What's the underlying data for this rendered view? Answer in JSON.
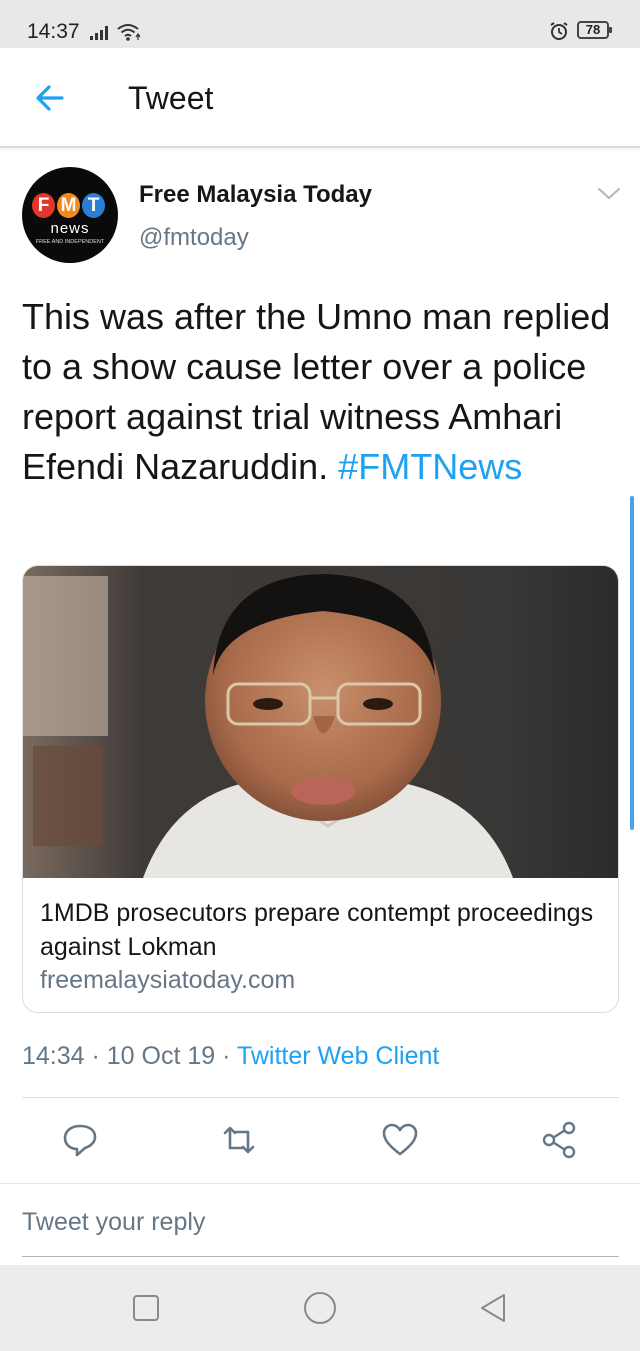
{
  "status_bar": {
    "time": "14:37",
    "battery": "78"
  },
  "app_bar": {
    "title": "Tweet"
  },
  "tweet": {
    "author": {
      "display_name": "Free Malaysia Today",
      "handle": "@fmtoday",
      "avatar": {
        "letters": [
          "F",
          "M",
          "T"
        ],
        "word": "news",
        "tagline": "FREE AND INDEPENDENT"
      }
    },
    "text": "This was after the Umno man replied to a show cause letter over a police report against trial witness Amhari Efendi Nazaruddin. ",
    "hashtag": "#FMTNews",
    "card": {
      "title": "1MDB prosecutors prepare contempt proceedings against Lokman",
      "domain": "freemalaysiatoday.com"
    },
    "time": "14:34",
    "date": "10 Oct 19",
    "separator": " · ",
    "client": "Twitter Web Client"
  },
  "reply": {
    "placeholder": "Tweet your reply"
  },
  "colors": {
    "accent": "#1da1f2",
    "secondary_text": "#657786",
    "fmt_red": "#e0362c",
    "fmt_orange": "#f08a1d",
    "fmt_blue": "#2a7fd4"
  }
}
